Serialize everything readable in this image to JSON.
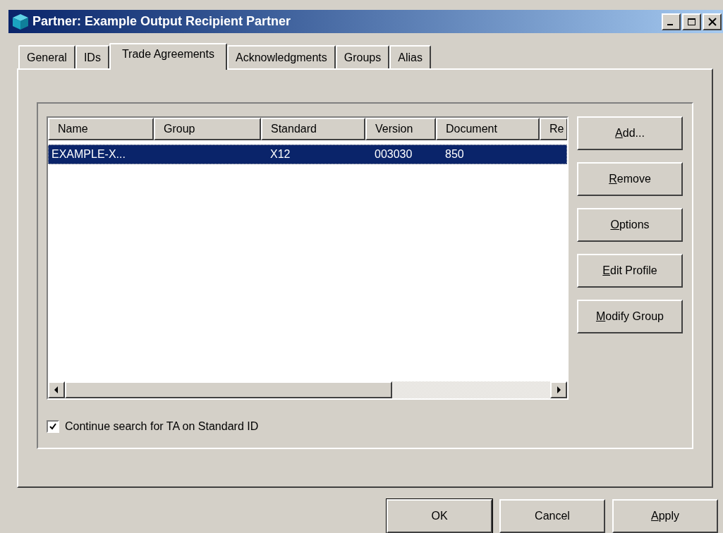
{
  "window": {
    "title": "Partner: Example Output Recipient Partner"
  },
  "tabs": [
    {
      "label": "General",
      "selected": false
    },
    {
      "label": "IDs",
      "selected": false
    },
    {
      "label": "Trade Agreements",
      "selected": true
    },
    {
      "label": "Acknowledgments",
      "selected": false
    },
    {
      "label": "Groups",
      "selected": false
    },
    {
      "label": "Alias",
      "selected": false
    }
  ],
  "table": {
    "columns": [
      "Name",
      "Group",
      "Standard",
      "Version",
      "Document",
      "Re"
    ],
    "rows": [
      {
        "cells": [
          "EXAMPLE-X...",
          "",
          "X12",
          "003030",
          "850"
        ],
        "selected": true
      }
    ]
  },
  "side_buttons": [
    {
      "label": "Add...",
      "mnemonic_underlined": true
    },
    {
      "label": "Remove",
      "mnemonic_underlined": true
    },
    {
      "label": "Options",
      "mnemonic_underlined": true
    },
    {
      "label": "Edit Profile",
      "mnemonic_underlined": true
    },
    {
      "label": "Modify Group",
      "mnemonic_underlined": true
    }
  ],
  "checkbox": {
    "label": "Continue search for TA on Standard ID",
    "checked": true
  },
  "buttons": [
    {
      "label": "OK",
      "default": true,
      "mnemonic_underlined": false
    },
    {
      "label": "Cancel",
      "default": false,
      "mnemonic_underlined": false
    },
    {
      "label": "Apply",
      "default": false,
      "mnemonic_underlined": true
    }
  ]
}
